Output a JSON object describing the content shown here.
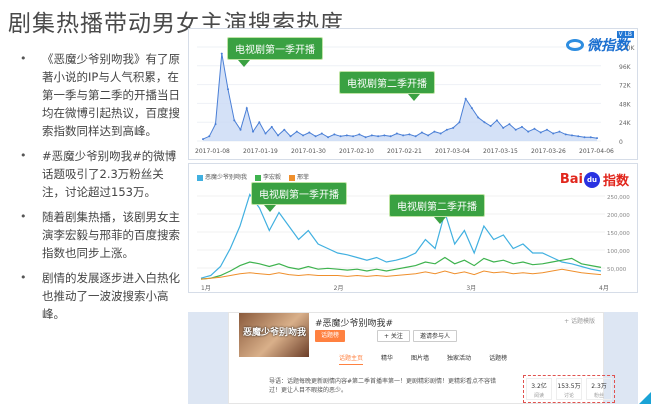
{
  "title": "剧集热播带动男女主演搜索热度",
  "bullets": [
    "《恶魔少爷别吻我》有了原著小说的IP与人气积累，在第一季与第二季的开播当日均在微博引起热议，百度搜索指数同样达到高峰。",
    "#恶魔少爷别吻我#的微博话题吸引了2.3万粉丝关注，讨论超过153万。",
    "随着剧集热播，该剧男女主演李宏毅与邢菲的百度搜索指数也同步上涨。",
    "剧情的发展逐步进入白热化也推动了一波波搜索小高峰。"
  ],
  "weibo": {
    "logo": "微指数",
    "badge": "V LB",
    "callout1": "电视剧第一季开播",
    "callout2": "电视剧第二季开播",
    "x_ticks": [
      "2017-01-08",
      "2017-01-19",
      "2017-01-30",
      "2017-02-10",
      "2017-02-21",
      "2017-03-04",
      "2017-03-15",
      "2017-03-26",
      "2017-04-06"
    ],
    "y_ticks": [
      "120K",
      "96K",
      "72K",
      "48K",
      "24K",
      "0"
    ],
    "line_color": "#4a7fd6",
    "fill_color": "#c9daf5"
  },
  "baidu": {
    "logo_left": "Bai",
    "logo_paw": "du",
    "logo_right": "指数",
    "callout1": "电视剧第一季开播",
    "callout2": "电视剧第二季开播",
    "legend": [
      {
        "label": "恶魔少爷别吻我",
        "color": "#41b0e0"
      },
      {
        "label": "李宏毅",
        "color": "#3fb34f"
      },
      {
        "label": "邢菲",
        "color": "#ef8f2c"
      }
    ],
    "y_ticks": [
      "250,000",
      "200,000",
      "150,000",
      "100,000",
      "50,000"
    ],
    "x_ticks": [
      "1月",
      "2月",
      "3月",
      "4月"
    ]
  },
  "topic": {
    "poster_text": "恶魔少爷别吻我",
    "name": "#恶魔少爷别吻我#",
    "module_label": "+ 话题模版",
    "btn_main": "话题榜",
    "btn_follow": "+ 关注",
    "btn_invite": "邀请参与人",
    "tabs": [
      "话题主页",
      "精华",
      "图片墙",
      "独家活动",
      "话题榜"
    ],
    "intro": "导语：话题每晚更新剧情内容#第二季首播率第一！更剧精彩剧情！更精彩看点不容错过！更让人目不暇接的恶少。",
    "stats": [
      {
        "value": "3.2亿",
        "label": "阅读"
      },
      {
        "value": "153.5万",
        "label": "讨论"
      },
      {
        "value": "2.3万",
        "label": "粉丝"
      }
    ]
  }
}
